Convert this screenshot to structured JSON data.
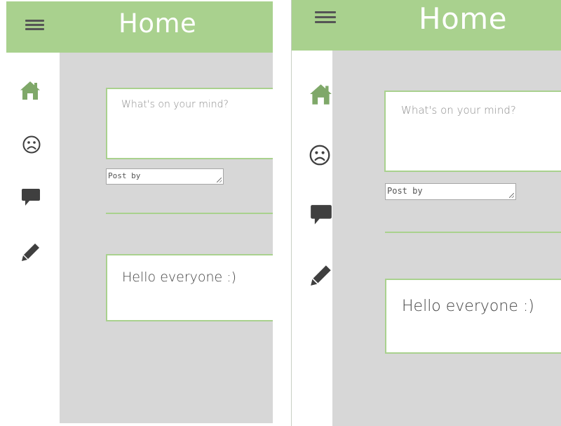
{
  "screens": [
    {
      "header": {
        "title": "Home",
        "menu_icon": "hamburger-icon"
      },
      "sidebar": {
        "items": [
          {
            "icon": "home-icon",
            "active": true
          },
          {
            "icon": "sad-face-icon",
            "active": false
          },
          {
            "icon": "comment-icon",
            "active": false
          },
          {
            "icon": "pencil-icon",
            "active": false
          }
        ]
      },
      "composer": {
        "placeholder": "What's on your mind?",
        "post_by_placeholder": "Post by"
      },
      "posts": [
        {
          "text": "Hello everyone :)"
        }
      ]
    },
    {
      "header": {
        "title": "Home",
        "menu_icon": "hamburger-icon"
      },
      "sidebar": {
        "items": [
          {
            "icon": "home-icon",
            "active": true
          },
          {
            "icon": "sad-face-icon",
            "active": false
          },
          {
            "icon": "comment-icon",
            "active": false
          },
          {
            "icon": "pencil-icon",
            "active": false
          }
        ]
      },
      "composer": {
        "placeholder": "What's on your mind?",
        "post_by_placeholder": "Post by"
      },
      "posts": [
        {
          "text": "Hello everyone :)"
        }
      ]
    }
  ],
  "colors": {
    "accent": "#a9d18e",
    "active_icon": "#7fa869",
    "icon": "#3f3f3f",
    "content_bg": "#d7d7d7",
    "header_text": "#ffffff"
  }
}
